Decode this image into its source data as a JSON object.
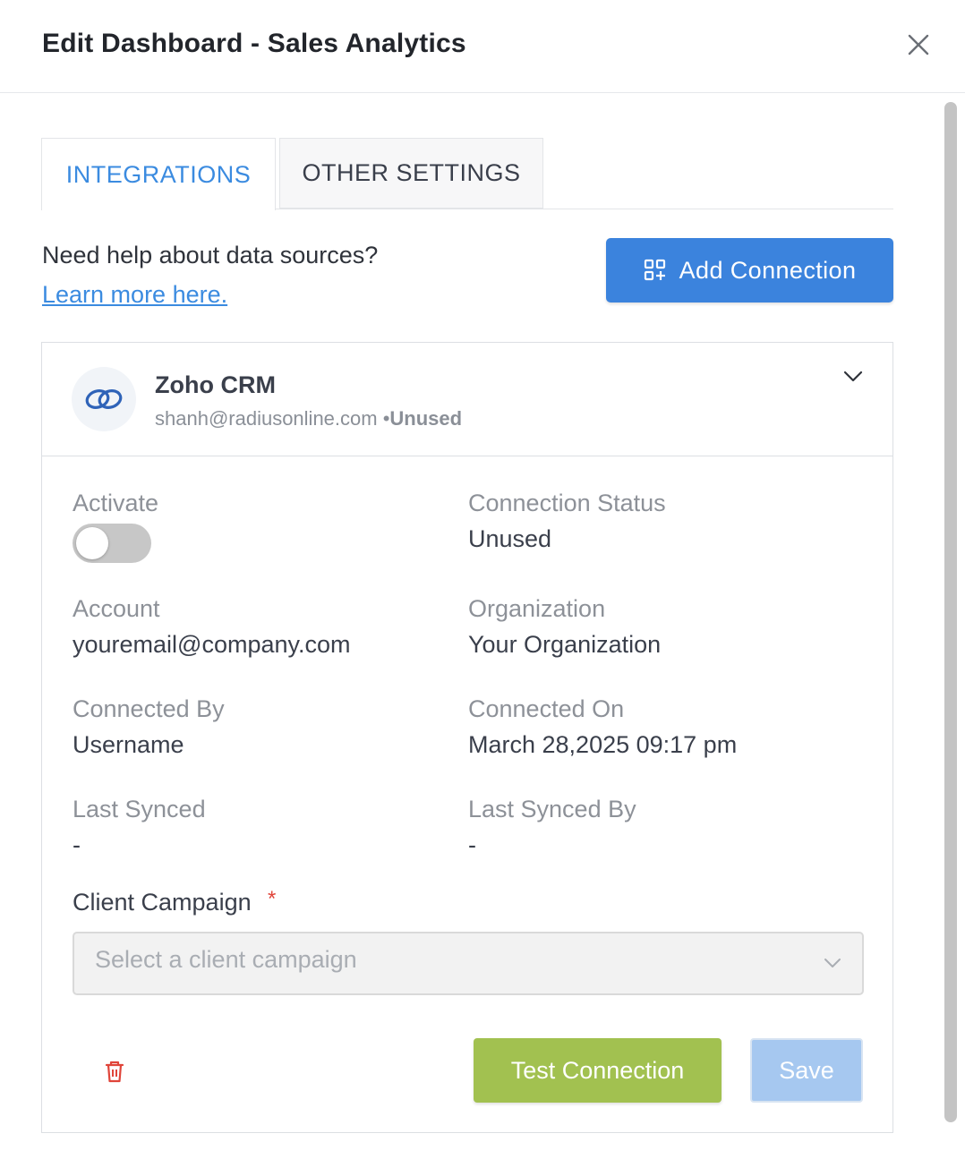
{
  "header": {
    "title": "Edit Dashboard - Sales Analytics"
  },
  "tabs": [
    {
      "label": "INTEGRATIONS",
      "active": true
    },
    {
      "label": "OTHER SETTINGS",
      "active": false
    }
  ],
  "help": {
    "text": "Need help about data sources?",
    "link": "Learn more here."
  },
  "add_connection_label": "Add Connection",
  "connection": {
    "name": "Zoho CRM",
    "email": "shanh@radiusonline.com",
    "separator": " •",
    "status": "Unused",
    "fields": {
      "activate_label": "Activate",
      "activate_on": false,
      "connection_status_label": "Connection Status",
      "connection_status_value": "Unused",
      "account_label": "Account",
      "account_value": "youremail@company.com",
      "organization_label": "Organization",
      "organization_value": "Your Organization",
      "connected_by_label": "Connected By",
      "connected_by_value": "Username",
      "connected_on_label": "Connected On",
      "connected_on_value": "March 28,2025 09:17 pm",
      "last_synced_label": "Last Synced",
      "last_synced_value": "-",
      "last_synced_by_label": "Last Synced By",
      "last_synced_by_value": "-"
    },
    "campaign": {
      "label": "Client Campaign",
      "required_mark": "*",
      "placeholder": "Select a client campaign"
    },
    "test_label": "Test Connection",
    "save_label": "Save"
  },
  "colors": {
    "accent": "#3b83dd",
    "link": "#3b8be0",
    "test_button": "#a2c150",
    "save_button_disabled": "#a6c8f0",
    "danger": "#e0453a"
  },
  "icons": {
    "close": "close-icon",
    "add": "add-grid-icon",
    "integration": "link-rings-icon",
    "expand": "chevron-down-icon",
    "delete": "trash-icon"
  }
}
